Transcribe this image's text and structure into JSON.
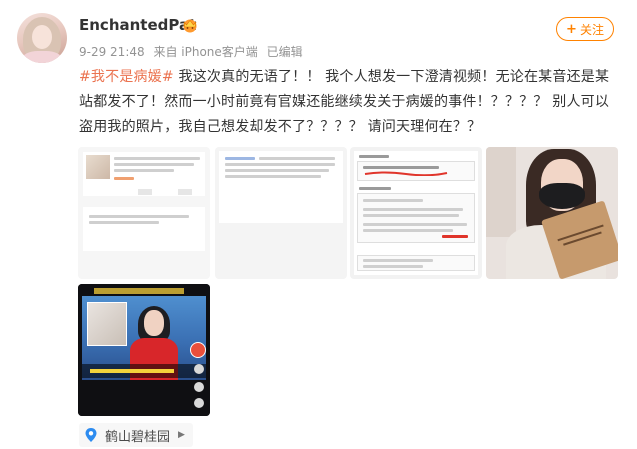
{
  "user": {
    "name": "EnchantedPat",
    "badge_icon": "vip-crown-icon",
    "avatar_icon": "user-avatar"
  },
  "meta": {
    "time": "9-29 21:48",
    "source": "来自 iPhone客户端",
    "edited": "已编辑"
  },
  "follow": {
    "label": "关注",
    "plus": "+",
    "color": "#ff8200"
  },
  "post": {
    "hashtag": "#我不是病媛#",
    "body": " 我这次真的无语了！！ 我个人想发一下澄清视频！无论在某音还是某站都发不了！然而一小时前竟有官媒还能继续发关于病媛的事件！？？？？ 别人可以盗用我的照片，我自己想发却发不了？？？？ 请问天理何在？？",
    "hashtag_color": "#eb7350"
  },
  "images": {
    "count": 5,
    "thumbs": [
      "screenshot-app-list",
      "screenshot-document",
      "screenshot-review-notice",
      "photo-woman-masked-bag",
      "video-news-anchor"
    ]
  },
  "location": {
    "label": "鹤山碧桂园",
    "icon": "map-pin-icon"
  }
}
